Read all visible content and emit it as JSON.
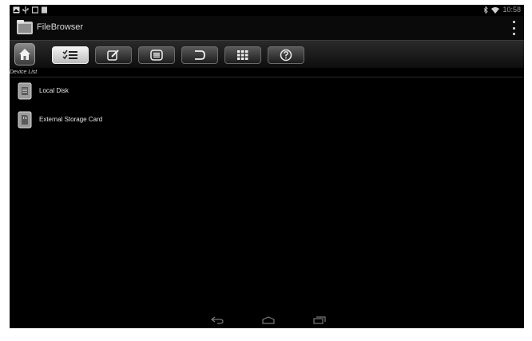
{
  "status_bar": {
    "left_icons": [
      "notification-image-icon",
      "notification-usb-icon",
      "notification-device-icon",
      "notification-sd-icon"
    ],
    "right_icons": [
      "bluetooth-icon",
      "wifi-icon"
    ],
    "time": "10:58"
  },
  "action_bar": {
    "app_title": "FileBrowser",
    "app_icon": "folder-icon",
    "overflow_icon": "overflow-menu-icon"
  },
  "toolbar": {
    "home_icon": "home-icon",
    "buttons": [
      {
        "icon": "checklist-icon",
        "active": true
      },
      {
        "icon": "edit-icon",
        "active": false
      },
      {
        "icon": "list-icon",
        "active": false
      },
      {
        "icon": "undo-icon",
        "active": false
      },
      {
        "icon": "grid-icon",
        "active": false
      },
      {
        "icon": "help-icon",
        "active": false
      }
    ]
  },
  "device_list": {
    "header": "Device List",
    "items": [
      {
        "label": "Local Disk",
        "icon": "disk-icon"
      },
      {
        "label": "External Storage Card",
        "icon": "sd-card-icon"
      }
    ]
  },
  "nav_bar": {
    "icons": [
      "back-icon",
      "home-nav-icon",
      "recents-icon"
    ]
  },
  "colors": {
    "background": "#000000",
    "toolbar_active": "#e0e0e0",
    "text": "#e6e6e6"
  }
}
